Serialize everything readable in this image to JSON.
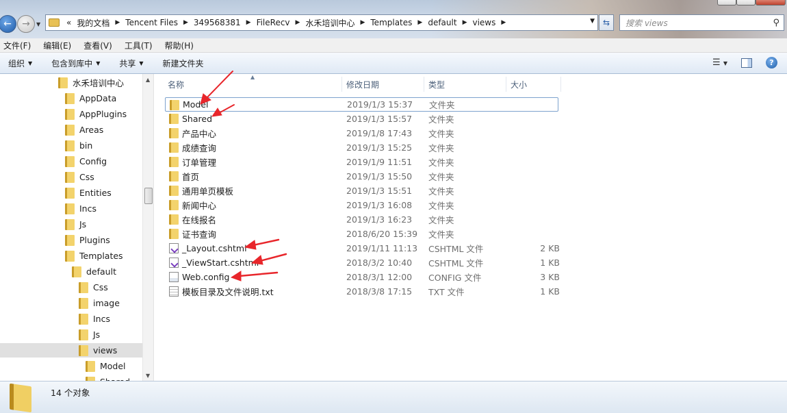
{
  "address": {
    "crumbs": [
      "我的文档",
      "Tencent Files",
      "349568381",
      "FileRecv",
      "水禾培训中心",
      "Templates",
      "default",
      "views"
    ],
    "overflow": "«"
  },
  "search": {
    "placeholder": "搜索 views"
  },
  "menu": [
    "文件(F)",
    "编辑(E)",
    "查看(V)",
    "工具(T)",
    "帮助(H)"
  ],
  "toolbar": {
    "organize": "组织",
    "include_library": "包含到库中",
    "share": "共享",
    "new_folder": "新建文件夹"
  },
  "tree": [
    {
      "label": "水禾培训中心",
      "level": 0
    },
    {
      "label": "AppData",
      "level": 1
    },
    {
      "label": "AppPlugins",
      "level": 1
    },
    {
      "label": "Areas",
      "level": 1
    },
    {
      "label": "bin",
      "level": 1
    },
    {
      "label": "Config",
      "level": 1
    },
    {
      "label": "Css",
      "level": 1
    },
    {
      "label": "Entities",
      "level": 1
    },
    {
      "label": "Incs",
      "level": 1
    },
    {
      "label": "Js",
      "level": 1
    },
    {
      "label": "Plugins",
      "level": 1
    },
    {
      "label": "Templates",
      "level": 1
    },
    {
      "label": "default",
      "level": 2
    },
    {
      "label": "Css",
      "level": 3
    },
    {
      "label": "image",
      "level": 3
    },
    {
      "label": "Incs",
      "level": 3
    },
    {
      "label": "Js",
      "level": 3
    },
    {
      "label": "views",
      "level": 3,
      "selected": true
    },
    {
      "label": "Model",
      "level": 4
    },
    {
      "label": "Shared",
      "level": 4
    }
  ],
  "columns": {
    "name": "名称",
    "date": "修改日期",
    "type": "类型",
    "size": "大小"
  },
  "files": [
    {
      "name": "Model",
      "date": "2019/1/3 15:37",
      "type": "文件夹",
      "size": "",
      "icon": "folder"
    },
    {
      "name": "Shared",
      "date": "2019/1/3 15:57",
      "type": "文件夹",
      "size": "",
      "icon": "folder"
    },
    {
      "name": "产品中心",
      "date": "2019/1/8 17:43",
      "type": "文件夹",
      "size": "",
      "icon": "folder"
    },
    {
      "name": "成绩查询",
      "date": "2019/1/3 15:25",
      "type": "文件夹",
      "size": "",
      "icon": "folder"
    },
    {
      "name": "订单管理",
      "date": "2019/1/9 11:51",
      "type": "文件夹",
      "size": "",
      "icon": "folder"
    },
    {
      "name": "首页",
      "date": "2019/1/3 15:50",
      "type": "文件夹",
      "size": "",
      "icon": "folder"
    },
    {
      "name": "通用单页模板",
      "date": "2019/1/3 15:51",
      "type": "文件夹",
      "size": "",
      "icon": "folder"
    },
    {
      "name": "新闻中心",
      "date": "2019/1/3 16:08",
      "type": "文件夹",
      "size": "",
      "icon": "folder"
    },
    {
      "name": "在线报名",
      "date": "2019/1/3 16:23",
      "type": "文件夹",
      "size": "",
      "icon": "folder"
    },
    {
      "name": "证书查询",
      "date": "2018/6/20 15:39",
      "type": "文件夹",
      "size": "",
      "icon": "folder"
    },
    {
      "name": "_Layout.cshtml",
      "date": "2019/1/11 11:13",
      "type": "CSHTML 文件",
      "size": "2 KB",
      "icon": "cshtml"
    },
    {
      "name": "_ViewStart.cshtml",
      "date": "2018/3/2 10:40",
      "type": "CSHTML 文件",
      "size": "1 KB",
      "icon": "cshtml"
    },
    {
      "name": "Web.config",
      "date": "2018/3/1 12:00",
      "type": "CONFIG 文件",
      "size": "3 KB",
      "icon": "config"
    },
    {
      "name": "模板目录及文件说明.txt",
      "date": "2018/3/8 17:15",
      "type": "TXT 文件",
      "size": "1 KB",
      "icon": "txt"
    }
  ],
  "status": {
    "count_text": "14 个对象"
  },
  "colors": {
    "annotation_arrow": "#e8262b",
    "selection_border": "#7da2ce"
  }
}
